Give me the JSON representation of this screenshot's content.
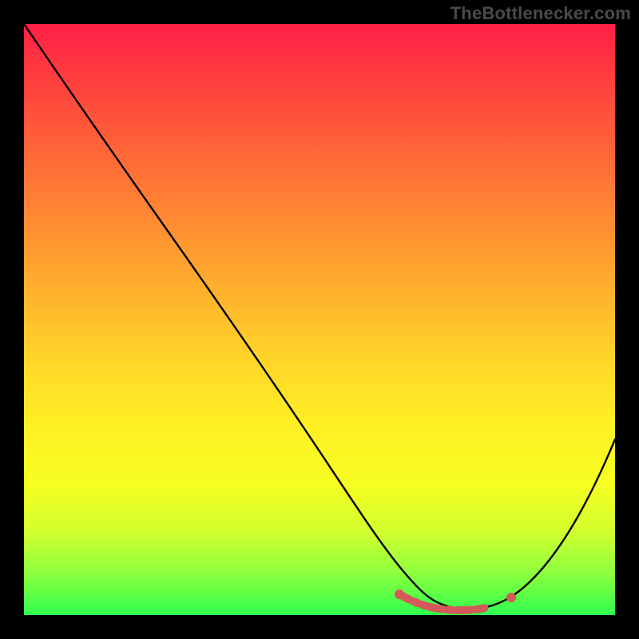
{
  "watermark": "TheBottlenecker.com",
  "chart_data": {
    "type": "line",
    "title": "",
    "xlabel": "",
    "ylabel": "",
    "xlim": [
      0,
      1
    ],
    "ylim": [
      0,
      1
    ],
    "series": [
      {
        "name": "bottleneck-curve",
        "x": [
          0.0,
          0.06,
          0.12,
          0.2,
          0.28,
          0.36,
          0.44,
          0.52,
          0.58,
          0.63,
          0.67,
          0.72,
          0.77,
          0.82,
          0.86,
          0.92,
          1.0
        ],
        "y": [
          1.0,
          0.93,
          0.84,
          0.72,
          0.6,
          0.48,
          0.36,
          0.24,
          0.14,
          0.07,
          0.03,
          0.01,
          0.01,
          0.02,
          0.05,
          0.13,
          0.3
        ],
        "color": "#000000"
      },
      {
        "name": "optimal-range-highlight",
        "x": [
          0.63,
          0.82
        ],
        "y": [
          0.03,
          0.03
        ],
        "color": "#d45a5a"
      }
    ],
    "gradient_background": {
      "top_color": "#ff1f47",
      "bottom_color": "#2eff4e"
    }
  }
}
